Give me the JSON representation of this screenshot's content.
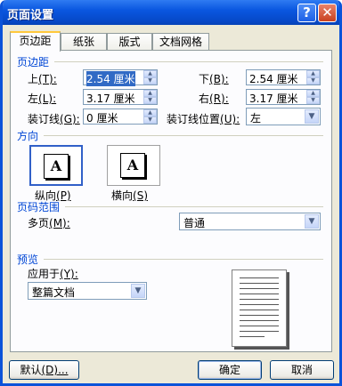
{
  "window": {
    "title": "页面设置",
    "help_glyph": "?",
    "close_glyph": "✕"
  },
  "tabs": [
    "页边距",
    "纸张",
    "版式",
    "文档网格"
  ],
  "margins": {
    "group_label": "页边距",
    "top": {
      "label": "上",
      "key": "(T):",
      "value": "2.54 厘米"
    },
    "bottom": {
      "label": "下",
      "key": "(B):",
      "value": "2.54 厘米"
    },
    "left": {
      "label": "左",
      "key": "(L):",
      "value": "3.17 厘米"
    },
    "right": {
      "label": "右",
      "key": "(R):",
      "value": "3.17 厘米"
    },
    "gutter": {
      "label": "装订线",
      "key": "(G):",
      "value": "0 厘米"
    },
    "gutter_pos": {
      "label": "装订线位置",
      "key": "(U):",
      "value": "左"
    }
  },
  "orientation": {
    "group_label": "方向",
    "glyph": "A",
    "portrait": {
      "label": "纵向",
      "key": "(P)",
      "selected": true
    },
    "landscape": {
      "label": "横向",
      "key": "(S)",
      "selected": false
    }
  },
  "pages": {
    "group_label": "页码范围",
    "label": "多页",
    "key": "(M):",
    "value": "普通"
  },
  "preview": {
    "group_label": "预览",
    "apply_label": "应用于",
    "apply_key": "(Y):",
    "apply_value": "整篇文档"
  },
  "buttons": {
    "default": "默认",
    "default_key": "(D)...",
    "ok": "确定",
    "cancel": "取消"
  }
}
